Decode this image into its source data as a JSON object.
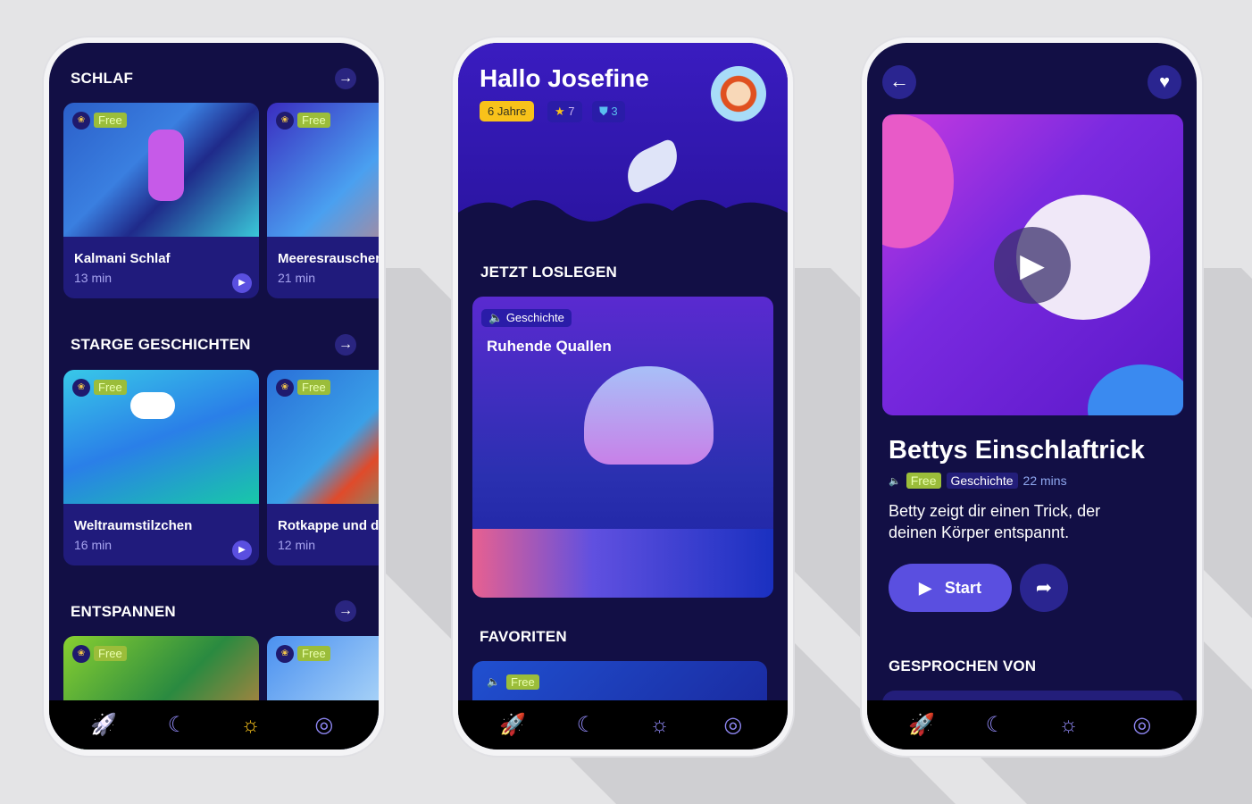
{
  "colors": {
    "bg": "#120f45",
    "card": "#201b7c",
    "accent": "#5a4fe0",
    "free": "#9bbd3a",
    "pill": "#f8c21a"
  },
  "phone1": {
    "sections": [
      {
        "title": "SCHLAF",
        "cards": [
          {
            "title": "Kalmani Schlaf",
            "duration": "13 min",
            "badge": "Free"
          },
          {
            "title": "Meeresrauschen",
            "duration": "21 min",
            "badge": "Free"
          }
        ]
      },
      {
        "title": "STARGE GESCHICHTEN",
        "cards": [
          {
            "title": "Weltraumstilzchen",
            "duration": "16 min",
            "badge": "Free"
          },
          {
            "title": "Rotkappe und der Wolf",
            "duration": "12 min",
            "badge": "Free"
          }
        ]
      },
      {
        "title": "ENTSPANNEN",
        "cards": [
          {
            "badge": "Free"
          },
          {
            "badge": "Free"
          }
        ]
      }
    ],
    "nav_active": "sun-icon"
  },
  "phone2": {
    "greeting": "Hallo Josefine",
    "age": "6 Jahre",
    "stars": "7",
    "shields": "3",
    "section1": "JETZT LOSLEGEN",
    "feature": {
      "tag": "Geschichte",
      "title": "Ruhende Quallen"
    },
    "section2": "FAVORITEN",
    "fav_badge": "Free",
    "nav_active": "rocket-icon"
  },
  "phone3": {
    "title": "Bettys Einschlaftrick",
    "badge": "Free",
    "category": "Geschichte",
    "duration": "22 mins",
    "description": "Betty zeigt dir einen Trick, der deinen Körper entspannt.",
    "start": "Start",
    "section": "GESPROCHEN VON",
    "nav_active": "rocket-icon"
  },
  "icons": {
    "play": "▶",
    "arrow": "→",
    "back": "←",
    "heart": "♥",
    "share": "➦",
    "speaker": "🔈",
    "rocket": "🚀",
    "moon": "☾",
    "sun": "☼",
    "profile": "◎",
    "star": "★",
    "shield": "⛊",
    "lotus": "❀"
  }
}
